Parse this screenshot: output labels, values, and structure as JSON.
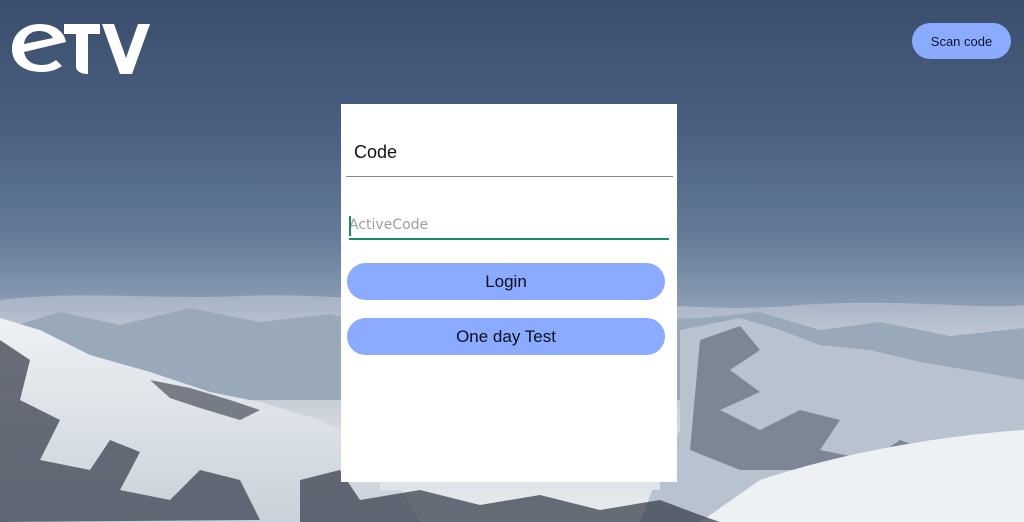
{
  "app": {
    "logo_text": "ETV",
    "logo_icon": "etv-logo"
  },
  "header": {
    "scan_label": "Scan code"
  },
  "login_panel": {
    "title": "Code",
    "code_input": {
      "value": "",
      "placeholder": "ActiveCode"
    },
    "login_label": "Login",
    "test_label": "One day Test"
  },
  "colors": {
    "button_bg": "#8aabff",
    "input_underline": "#1b8a6b",
    "panel_bg": "#ffffff"
  }
}
